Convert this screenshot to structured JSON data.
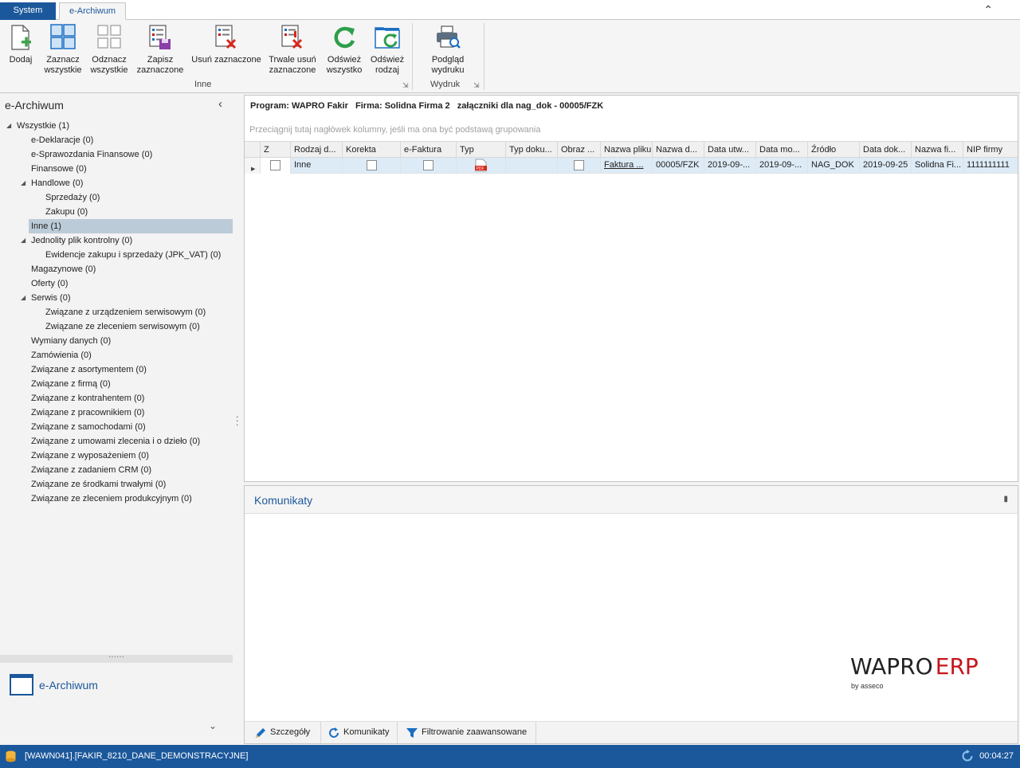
{
  "tabs": {
    "system": "System",
    "earchiwum": "e-Archiwum"
  },
  "ribbon": {
    "buttons": {
      "dodaj": "Dodaj",
      "zaznacz_1": "Zaznacz",
      "zaznacz_2": "wszystkie",
      "odznacz_1": "Odznacz",
      "odznacz_2": "wszystkie",
      "zapisz_1": "Zapisz",
      "zapisz_2": "zaznaczone",
      "usun": "Usuń zaznaczone",
      "trwale_1": "Trwale usuń",
      "trwale_2": "zaznaczone",
      "odswiez_wsz_1": "Odśwież",
      "odswiez_wsz_2": "wszystko",
      "odswiez_rod_1": "Odśwież",
      "odswiez_rod_2": "rodzaj",
      "podglad_1": "Podgląd",
      "podglad_2": "wydruku"
    },
    "groups": {
      "inne": "Inne",
      "wydruk": "Wydruk"
    }
  },
  "left": {
    "title": "e-Archiwum",
    "tree": [
      {
        "label": "Wszystkie (1)"
      },
      {
        "label": "e-Deklaracje (0)"
      },
      {
        "label": "e-Sprawozdania Finansowe (0)"
      },
      {
        "label": "Finansowe (0)"
      },
      {
        "label": "Handlowe (0)"
      },
      {
        "label": "Sprzedaży (0)"
      },
      {
        "label": "Zakupu (0)"
      },
      {
        "label": "Inne (1)"
      },
      {
        "label": "Jednolity plik kontrolny (0)"
      },
      {
        "label": "Ewidencje zakupu i sprzedaży (JPK_VAT) (0)"
      },
      {
        "label": "Magazynowe (0)"
      },
      {
        "label": "Oferty (0)"
      },
      {
        "label": "Serwis (0)"
      },
      {
        "label": "Związane z urządzeniem serwisowym (0)"
      },
      {
        "label": "Związane ze zleceniem serwisowym (0)"
      },
      {
        "label": "Wymiany danych (0)"
      },
      {
        "label": "Zamówienia (0)"
      },
      {
        "label": "Związane z asortymentem (0)"
      },
      {
        "label": "Związane z firmą (0)"
      },
      {
        "label": "Związane z kontrahentem (0)"
      },
      {
        "label": "Związane z pracownikiem (0)"
      },
      {
        "label": "Związane z samochodami (0)"
      },
      {
        "label": "Związane z umowami zlecenia i o dzieło (0)"
      },
      {
        "label": "Związane z wyposażeniem (0)"
      },
      {
        "label": "Związane z zadaniem CRM (0)"
      },
      {
        "label": "Związane ze środkami trwałymi (0)"
      },
      {
        "label": "Związane ze zleceniem produkcyjnym (0)"
      }
    ],
    "nav_item": "e-Archiwum"
  },
  "main": {
    "caption": "Program: WAPRO Fakir   Firma: Solidna Firma 2   załączniki dla nag_dok - 00005/FZK",
    "group_hint": "Przeciągnij tutaj nagłówek kolumny, jeśli ma ona być podstawą grupowania",
    "columns": [
      "Z",
      "Rodzaj d...",
      "Korekta",
      "e-Faktura",
      "Typ",
      "Typ doku...",
      "Obraz ...",
      "Nazwa pliku",
      "Nazwa d...",
      "Data utw...",
      "Data mo...",
      "Źródło",
      "Data dok...",
      "Nazwa fi...",
      "NIP firmy"
    ],
    "row": {
      "rodzaj": "Inne",
      "typ_icon": "pdf-icon",
      "nazwa_pliku": "Faktura ...",
      "nazwa_d": "00005/FZK",
      "data_utw": "2019-09-...",
      "data_mod": "2019-09-...",
      "zrodlo": "NAG_DOK",
      "data_dok": "2019-09-25",
      "nazwa_firmy": "Solidna Fi...",
      "nip": "1111111111"
    }
  },
  "messages": {
    "title": "Komunikaty",
    "logo_wapro": "WAPRO",
    "logo_erp": "ERP",
    "logo_by": "by asseco",
    "buttons": {
      "szczegoly": "Szczegóły",
      "komunikaty": "Komunikaty",
      "filtrowanie": "Filtrowanie zaawansowane"
    }
  },
  "status": {
    "connection": "[WAWN041].[FAKIR_8210_DANE_DEMONSTRACYJNE]",
    "time": "00:04:27"
  },
  "colors": {
    "accent": "#1b579b",
    "selection": "#bccbd8",
    "row_highlight": "#ddebf7",
    "erp_red": "#c4161c"
  }
}
